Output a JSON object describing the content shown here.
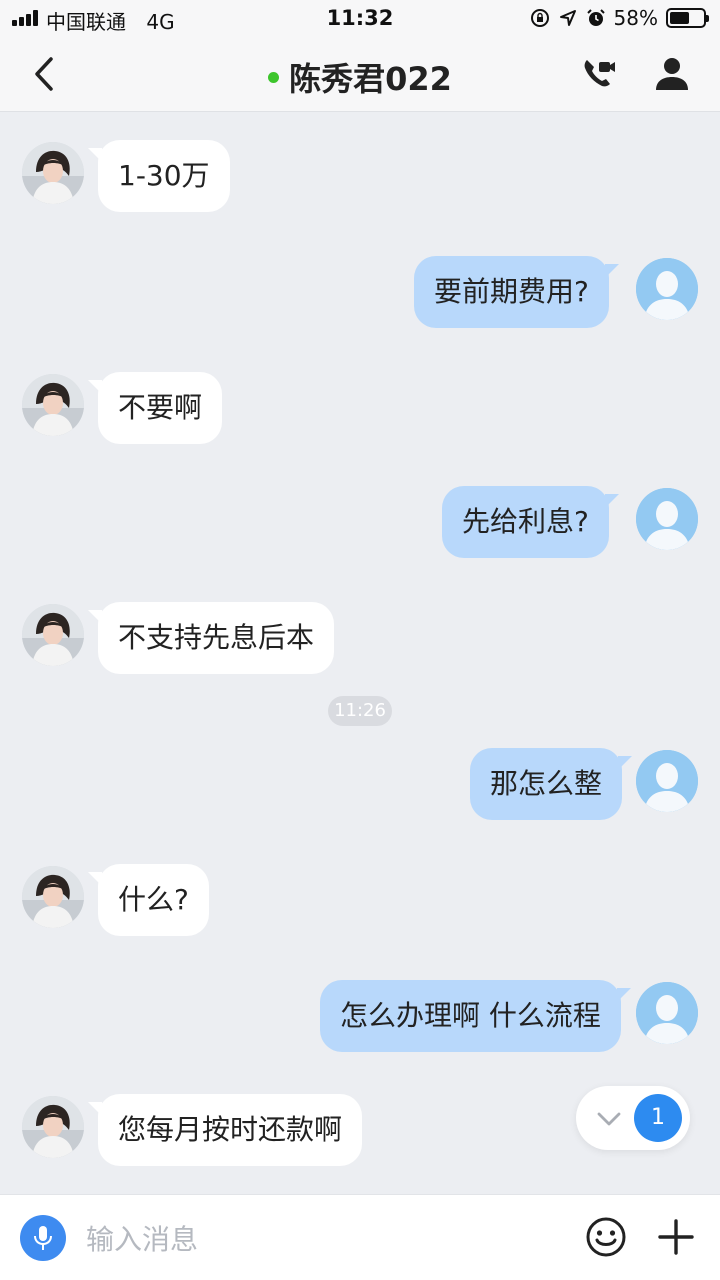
{
  "status_bar": {
    "carrier": "中国联通",
    "network": "4G",
    "time": "11:32",
    "battery_percent": "58%",
    "battery_level": 0.58,
    "icons": [
      "orientation-lock-icon",
      "location-arrow-icon",
      "alarm-icon"
    ]
  },
  "header": {
    "title": "陈秀君022",
    "online_color": "#3dc52c",
    "back_icon": "chevron-left-icon",
    "call_icon": "phone-video-icon",
    "profile_icon": "person-icon"
  },
  "messages": [
    {
      "side": "left",
      "text": "1-30万"
    },
    {
      "side": "right",
      "text": "要前期费用?"
    },
    {
      "side": "left",
      "text": "不要啊"
    },
    {
      "side": "right",
      "text": "先给利息?"
    },
    {
      "side": "left",
      "text": "不支持先息后本"
    },
    {
      "side": "right",
      "text": "那怎么整"
    },
    {
      "side": "left",
      "text": "什么?"
    },
    {
      "side": "right",
      "text": "怎么办理啊 什么流程"
    },
    {
      "side": "left",
      "text": "您每月按时还款啊"
    }
  ],
  "timestamp": "11:26",
  "unread": {
    "count": "1",
    "icon": "chevron-down-icon"
  },
  "input": {
    "placeholder": "输入消息",
    "value": "",
    "voice_icon": "microphone-icon",
    "emoji_icon": "smiley-icon",
    "plus_icon": "plus-icon"
  },
  "colors": {
    "accent": "#2d8bf0",
    "sent_bubble": "#b8d8fb",
    "received_bubble": "#ffffff",
    "background": "#eceef2"
  }
}
